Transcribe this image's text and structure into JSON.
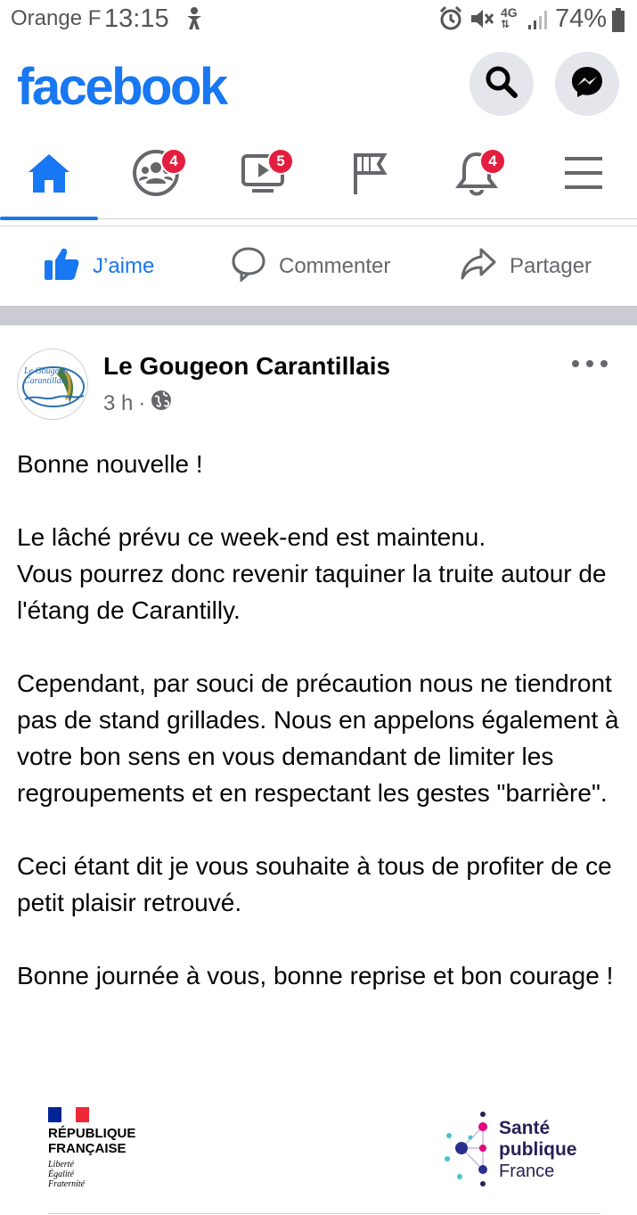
{
  "status_bar": {
    "carrier": "Orange F",
    "time": "13:15",
    "network": "4G",
    "battery": "74%"
  },
  "header": {
    "logo": "facebook",
    "icons": [
      "search-icon",
      "messenger-icon"
    ]
  },
  "nav": {
    "tabs": [
      {
        "name": "home",
        "icon": "home-icon",
        "active": true,
        "badge": ""
      },
      {
        "name": "groups",
        "icon": "groups-icon",
        "active": false,
        "badge": "4"
      },
      {
        "name": "watch",
        "icon": "video-icon",
        "active": false,
        "badge": "5"
      },
      {
        "name": "pages",
        "icon": "flag-icon",
        "active": false,
        "badge": ""
      },
      {
        "name": "notifications",
        "icon": "bell-icon",
        "active": false,
        "badge": "4"
      },
      {
        "name": "menu",
        "icon": "menu-icon",
        "active": false,
        "badge": ""
      }
    ]
  },
  "actions": {
    "like": "J’aime",
    "comment": "Commenter",
    "share": "Partager"
  },
  "post": {
    "author": "Le Gougeon Carantillais",
    "avatar_text": "Le Gougeon Carantillais",
    "time": "3 h",
    "paragraphs": [
      "Bonne nouvelle !",
      "Le lâché prévu ce week-end est maintenu.\nVous pourrez donc revenir taquiner la truite autour de l'étang de Carantilly.",
      "Cependant, par souci de précaution nous ne tiendront pas de stand grillades. Nous en appelons également à votre bon sens en vous demandant de limiter les regroupements et en respectant les gestes \"barrière\".",
      "Ceci étant dit je vous souhaite à tous de profiter de ce petit plaisir retrouvé.",
      "Bonne journée à vous, bonne reprise et bon courage !"
    ]
  },
  "attachment": {
    "rf_line1": "RÉPUBLIQUE",
    "rf_line2": "FRANÇAISE",
    "rf_motto1": "Liberté",
    "rf_motto2": "Égalité",
    "rf_motto3": "Fraternité",
    "spf_line1": "Santé",
    "spf_line2": "publique",
    "spf_line3": "France"
  },
  "colors": {
    "brand": "#1877f2",
    "badge": "#e41e3f",
    "secondary_text": "#65676b",
    "separator": "#c9ccd1"
  }
}
